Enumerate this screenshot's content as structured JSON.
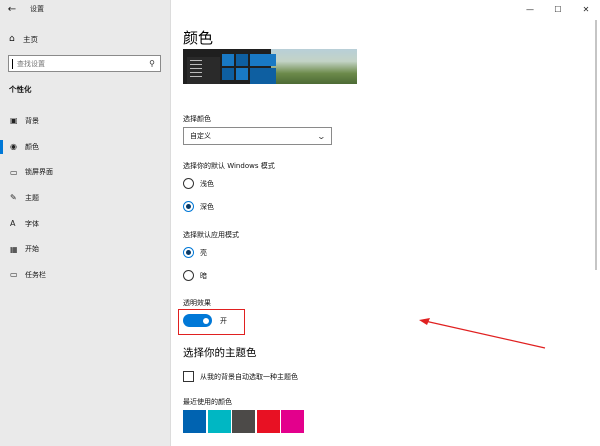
{
  "app": {
    "title": "设置",
    "back_icon": "arrow-left-icon"
  },
  "window_controls": {
    "minimize": "—",
    "maximize": "☐",
    "close": "✕"
  },
  "sidebar": {
    "home_label": "主页",
    "search_placeholder": "查找设置",
    "section_title": "个性化",
    "items": [
      {
        "label": "背景",
        "icon": "picture-icon",
        "glyph": "▣"
      },
      {
        "label": "颜色",
        "icon": "palette-icon",
        "glyph": "◉",
        "active": true
      },
      {
        "label": "锁屏界面",
        "icon": "lock-screen-icon",
        "glyph": "▭"
      },
      {
        "label": "主题",
        "icon": "brush-icon",
        "glyph": "✎"
      },
      {
        "label": "字体",
        "icon": "font-icon",
        "glyph": "A"
      },
      {
        "label": "开始",
        "icon": "start-icon",
        "glyph": "▦"
      },
      {
        "label": "任务栏",
        "icon": "taskbar-icon",
        "glyph": "▭"
      }
    ]
  },
  "main": {
    "title": "颜色",
    "choose_color_label": "选择颜色",
    "choose_color_value": "自定义",
    "windows_mode_label": "选择你的默认 Windows 模式",
    "windows_mode_options": [
      {
        "label": "浅色",
        "checked": false
      },
      {
        "label": "深色",
        "checked": true
      }
    ],
    "app_mode_label": "选择默认应用模式",
    "app_mode_options": [
      {
        "label": "亮",
        "checked": true
      },
      {
        "label": "暗",
        "checked": false
      }
    ],
    "transparency_label": "透明效果",
    "transparency_state": "开",
    "accent_title": "选择你的主题色",
    "auto_accent_label": "从我的背景自动选取一种主题色",
    "recent_colors_label": "最近使用的颜色",
    "recent_colors": [
      "#0063b1",
      "#00b7c3",
      "#4c4a48",
      "#e81123",
      "#e3008c"
    ],
    "accent_color": "#0078d7",
    "annotation_color": "#e02020"
  }
}
